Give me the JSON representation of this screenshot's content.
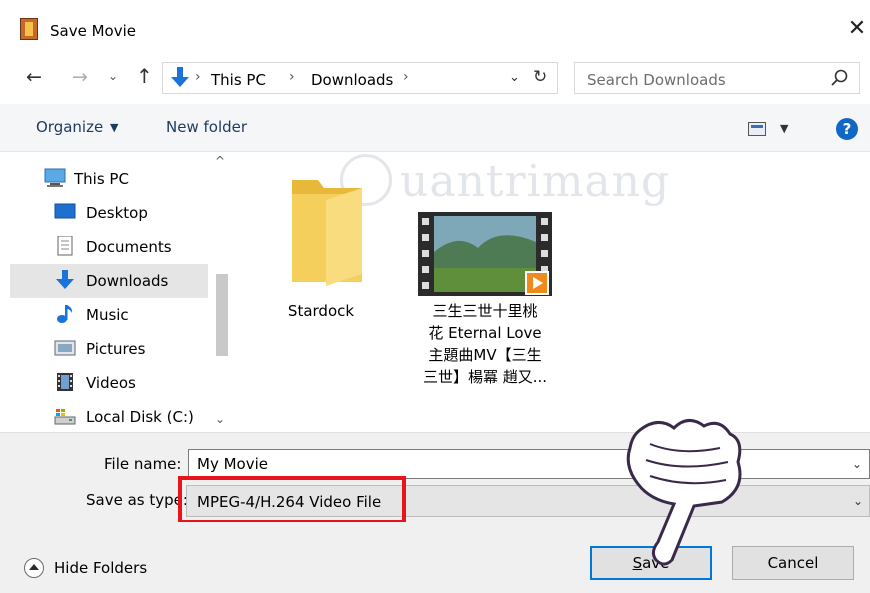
{
  "window": {
    "title": "Save Movie",
    "close_glyph": "✕"
  },
  "nav": {
    "back_glyph": "←",
    "forward_glyph": "→",
    "recent_glyph": "⌄",
    "up_glyph": "↑",
    "breadcrumb": [
      "This PC",
      "Downloads"
    ],
    "separator": "›",
    "dropdown_glyph": "⌄",
    "refresh_glyph": "↻"
  },
  "search": {
    "placeholder": "Search Downloads"
  },
  "toolbar": {
    "organize_label": "Organize",
    "caret": "▼",
    "new_folder_label": "New folder",
    "help_glyph": "?"
  },
  "sidebar": {
    "items": [
      {
        "label": "This PC",
        "icon": "pc-icon"
      },
      {
        "label": "Desktop",
        "icon": "desktop-icon"
      },
      {
        "label": "Documents",
        "icon": "documents-icon"
      },
      {
        "label": "Downloads",
        "icon": "downloads-icon",
        "selected": true
      },
      {
        "label": "Music",
        "icon": "music-icon"
      },
      {
        "label": "Pictures",
        "icon": "pictures-icon"
      },
      {
        "label": "Videos",
        "icon": "videos-icon"
      },
      {
        "label": "Local Disk (C:)",
        "icon": "disk-icon"
      }
    ],
    "scroll_up_glyph": "^",
    "scroll_down_glyph": "⌄"
  },
  "files": [
    {
      "name": "Stardock",
      "type": "folder"
    },
    {
      "name_lines": [
        "三生三世十里桃",
        "花 Eternal Love",
        "主題曲MV【三生",
        "三世】楊冪 趙又..."
      ],
      "type": "video"
    }
  ],
  "watermark": {
    "text": "uantrimang"
  },
  "fields": {
    "file_name_label": "File name:",
    "file_name_value": "My Movie",
    "save_as_type_label": "Save as type:",
    "save_as_type_value": "MPEG-4/H.264 Video File",
    "caret": "⌄"
  },
  "footer": {
    "hide_folders_label": "Hide Folders",
    "save_label": "Save",
    "cancel_label": "Cancel"
  },
  "colors": {
    "accent": "#0078d7",
    "highlight_box": "#e8141b",
    "selected_bg": "#e5e5e5",
    "folder_yellow": "#f5cf5b"
  }
}
